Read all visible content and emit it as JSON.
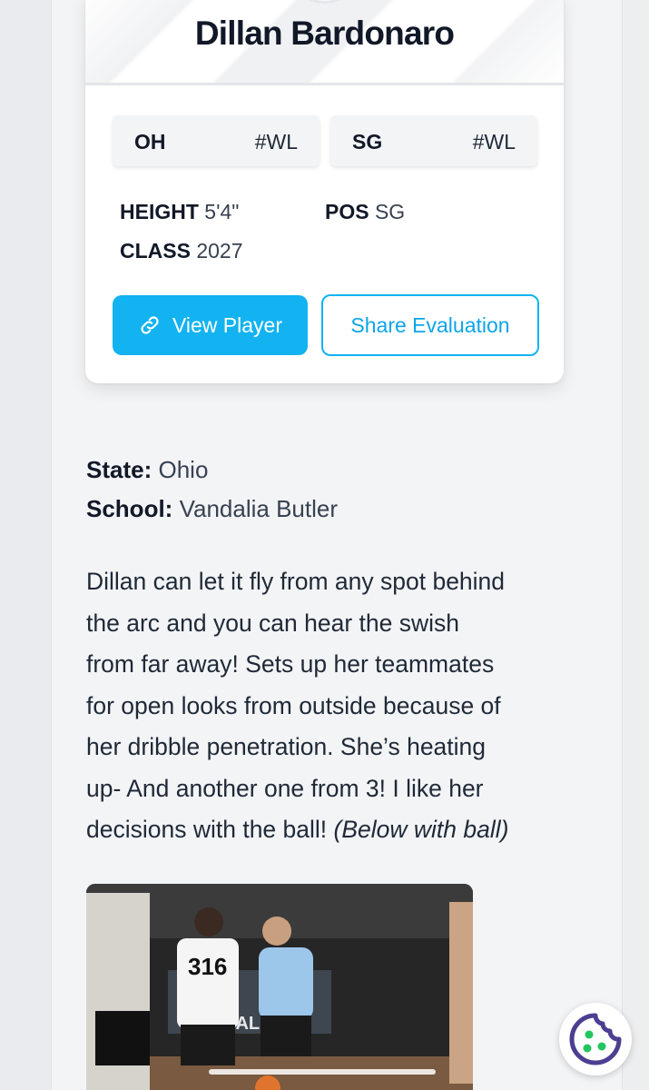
{
  "player": {
    "name": "Dillan Bardonaro",
    "rankings": [
      {
        "label": "OH",
        "value": "#WL"
      },
      {
        "label": "SG",
        "value": "#WL"
      }
    ],
    "stats": {
      "height_label": "HEIGHT",
      "height_value": "5'4\"",
      "pos_label": "POS",
      "pos_value": "SG",
      "class_label": "CLASS",
      "class_value": "2027"
    },
    "view_button": "View Player",
    "share_button": "Share Evaluation"
  },
  "details": {
    "state_label": "State:",
    "state_value": "Ohio",
    "school_label": "School:",
    "school_value": "Vandalia Butler"
  },
  "evaluation": {
    "line1": "Dillan can let it fly from any spot behind",
    "line2": "the arc and you can hear the swish",
    "line3": "from far away! Sets up her teammates",
    "line4": "for open looks from outside because of",
    "line5": "her dribble penetration. She’s heating",
    "line6": "up- And another one from 3!  I like her",
    "line7_text": "decisions with the ball! ",
    "line7_italic": "(Below with ball)"
  },
  "photo": {
    "jersey_number": "316",
    "banner_text": "BALLR"
  },
  "colors": {
    "accent": "#12b3f0",
    "cookie": "#4c3f91",
    "cookie_dots": "#22c55e"
  },
  "icons": {
    "link": "link-icon",
    "cookie": "cookie-icon"
  }
}
